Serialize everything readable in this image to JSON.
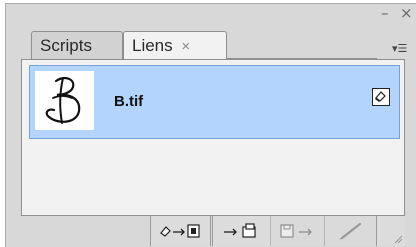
{
  "window": {
    "minimize_glyph": "–",
    "close_glyph": "×",
    "flyout_glyph": "▾☰"
  },
  "tabs": [
    {
      "label": "Scripts",
      "active": false
    },
    {
      "label": "Liens",
      "active": true,
      "close_glyph": "×"
    }
  ],
  "links": [
    {
      "filename": "B.tif",
      "thumbnail_icon": "handwritten-b-icon",
      "status_icon": "embedded-link-icon",
      "selected": true
    }
  ],
  "toolbar": {
    "buttons": [
      {
        "name": "relink-button",
        "icon": "relink-icon",
        "enabled": true
      },
      {
        "name": "go-to-link-button",
        "icon": "go-to-link-icon",
        "enabled": true
      },
      {
        "name": "update-link-button",
        "icon": "update-link-icon",
        "enabled": false
      },
      {
        "name": "edit-original-button",
        "icon": "edit-original-icon",
        "enabled": false
      }
    ]
  },
  "colors": {
    "panel_bg": "#d8d8d8",
    "list_bg": "#f2f2f2",
    "selection": "#b3d4fc"
  }
}
